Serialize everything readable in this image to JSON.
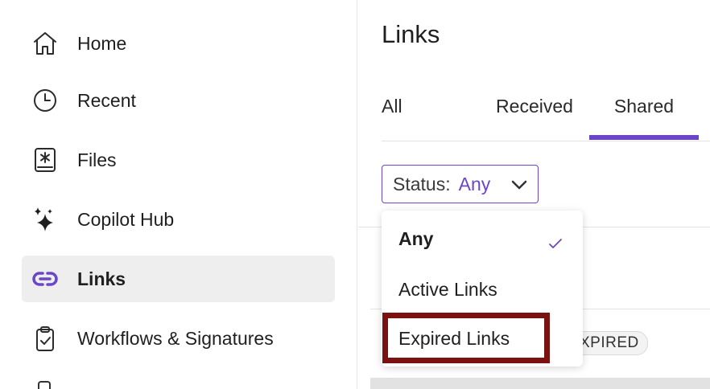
{
  "sidebar": {
    "items": [
      {
        "label": "Home",
        "icon": "home-icon",
        "active": false
      },
      {
        "label": "Recent",
        "icon": "clock-icon",
        "active": false
      },
      {
        "label": "Files",
        "icon": "files-icon",
        "active": false
      },
      {
        "label": "Copilot Hub",
        "icon": "sparkle-icon",
        "active": false
      },
      {
        "label": "Links",
        "icon": "link-icon",
        "active": true
      },
      {
        "label": "Workflows & Signatures",
        "icon": "clipboard-check-icon",
        "active": false
      }
    ]
  },
  "main": {
    "title": "Links",
    "tabs": [
      {
        "label": "All",
        "active": false
      },
      {
        "label": "Received",
        "active": false
      },
      {
        "label": "Shared",
        "active": true
      }
    ],
    "filter": {
      "label": "Status:",
      "value": "Any"
    },
    "row_badge": "XPIRED"
  },
  "dropdown": {
    "options": [
      {
        "label": "Any",
        "selected": true
      },
      {
        "label": "Active Links",
        "selected": false
      },
      {
        "label": "Expired Links",
        "selected": false
      }
    ]
  },
  "colors": {
    "accent": "#6b46c9",
    "highlight": "#7b1212",
    "active_nav_bg": "#eeeeee"
  }
}
